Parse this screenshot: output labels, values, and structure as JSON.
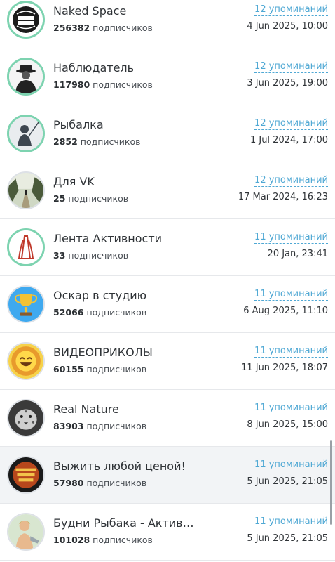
{
  "channels": [
    {
      "title": "Naked Space",
      "subs": "256382",
      "subs_suffix": "подписчиков",
      "mentions": "12 упоминаний",
      "date": "4 Jun 2025, 10:00",
      "avatar_icon": "naked-space-logo-icon",
      "ring": "green"
    },
    {
      "title": "Наблюдатель",
      "subs": "117980",
      "subs_suffix": "подписчиков",
      "mentions": "12 упоминаний",
      "date": "3 Jun 2025, 19:00",
      "avatar_icon": "man-in-hat-icon",
      "ring": "green"
    },
    {
      "title": "Рыбалка",
      "subs": "2852",
      "subs_suffix": "подписчиков",
      "mentions": "12 упоминаний",
      "date": "1 Jul 2024, 17:00",
      "avatar_icon": "fisherman-icon",
      "ring": "green"
    },
    {
      "title": "Для VK",
      "subs": "25",
      "subs_suffix": "подписчиков",
      "mentions": "12 упоминаний",
      "date": "17 Mar 2024, 16:23",
      "avatar_icon": "forest-path-icon",
      "ring": "grey"
    },
    {
      "title": "Лента Активности",
      "subs": "33",
      "subs_suffix": "подписчиков",
      "mentions": "11 упоминаний",
      "date": "20 Jan, 23:41",
      "avatar_icon": "olympic-tower-icon",
      "ring": "green"
    },
    {
      "title": "Оскар в студию",
      "subs": "52066",
      "subs_suffix": "подписчиков",
      "mentions": "11 упоминаний",
      "date": "6 Aug 2025, 11:10",
      "avatar_icon": "trophy-icon",
      "ring": "grey"
    },
    {
      "title": "ВИДЕОПРИКОЛЫ",
      "subs": "60155",
      "subs_suffix": "подписчиков",
      "mentions": "11 упоминаний",
      "date": "11 Jun 2025, 18:07",
      "avatar_icon": "laughing-emoji-icon",
      "ring": "grey"
    },
    {
      "title": "Real Nature",
      "subs": "83903",
      "subs_suffix": "подписчиков",
      "mentions": "11 упоминаний",
      "date": "8 Jun 2025, 15:00",
      "avatar_icon": "snow-leopard-icon",
      "ring": "grey"
    },
    {
      "title": "Выжить любой ценой!",
      "subs": "57980",
      "subs_suffix": "подписчиков",
      "mentions": "11 упоминаний",
      "date": "5 Jun 2025, 21:05",
      "avatar_icon": "survive-badge-icon",
      "ring": "grey"
    },
    {
      "title": "Будни Рыбака - Активн...",
      "subs": "101028",
      "subs_suffix": "подписчиков",
      "mentions": "11 упоминаний",
      "date": "5 Jun 2025, 21:05",
      "avatar_icon": "fisher-woman-icon",
      "ring": "grey"
    }
  ],
  "colors": {
    "accent": "#4fa8d4",
    "ring_green": "#7dd3b0",
    "highlight_row": "#f2f4f6"
  }
}
